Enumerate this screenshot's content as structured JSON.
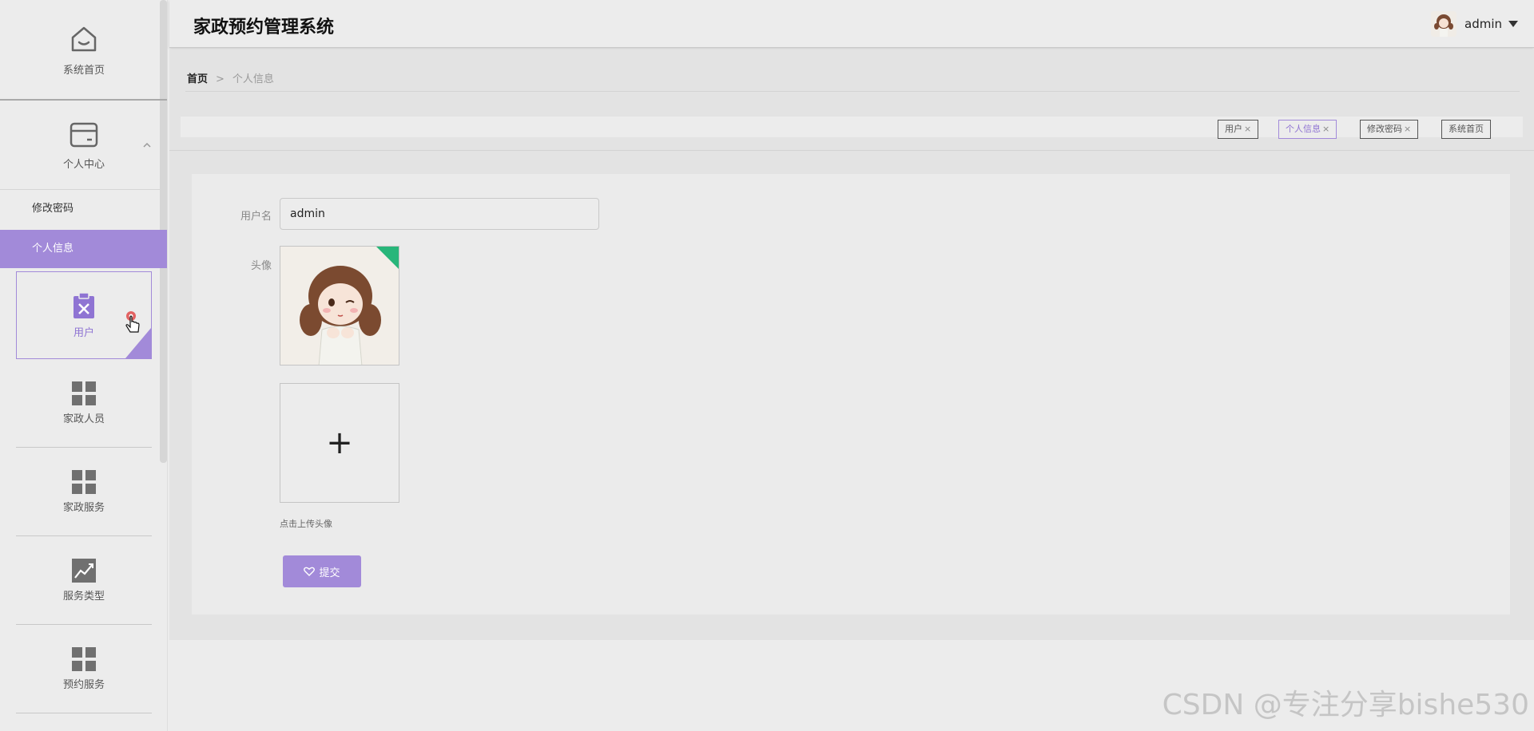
{
  "app": {
    "title": "家政预约管理系统"
  },
  "header": {
    "username": "admin"
  },
  "sidebar": {
    "home_label": "系统首页",
    "center_label": "个人中心",
    "sub_items": [
      {
        "label": "修改密码"
      },
      {
        "label": "个人信息"
      }
    ],
    "grid_items": [
      {
        "label": "用户"
      },
      {
        "label": "家政人员"
      },
      {
        "label": "家政服务"
      },
      {
        "label": "服务类型"
      },
      {
        "label": "预约服务"
      }
    ]
  },
  "breadcrumb": {
    "home": "首页",
    "separator": ">",
    "current": "个人信息"
  },
  "tabs": [
    {
      "label": "用户",
      "close": "×"
    },
    {
      "label": "个人信息",
      "close": "×"
    },
    {
      "label": "修改密码",
      "close": "×"
    },
    {
      "label": "系统首页",
      "close": ""
    }
  ],
  "form": {
    "username_label": "用户名",
    "username_value": "admin",
    "avatar_label": "头像",
    "upload_plus": "+",
    "upload_hint": "点击上传头像",
    "submit_label": "提交"
  },
  "watermark": "CSDN @专注分享bishe530",
  "colors": {
    "accent": "#a28ad9",
    "badge": "#28b67a"
  }
}
